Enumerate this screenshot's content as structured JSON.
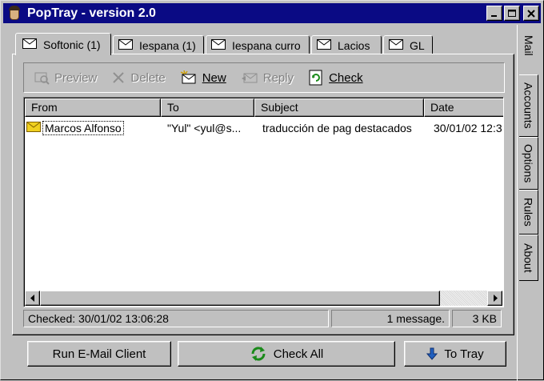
{
  "window": {
    "title": "PopTray - version 2.0"
  },
  "tabs": [
    {
      "label": "Softonic (1)",
      "active": true
    },
    {
      "label": "Iespana (1)",
      "active": false
    },
    {
      "label": "Iespana curro",
      "active": false
    },
    {
      "label": "Lacios",
      "active": false
    },
    {
      "label": "GL",
      "active": false
    }
  ],
  "toolbar": {
    "preview": "Preview",
    "delete": "Delete",
    "new": "New",
    "reply": "Reply",
    "check": "Check"
  },
  "list": {
    "columns": [
      "From",
      "To",
      "Subject",
      "Date"
    ],
    "rows": [
      {
        "from": "Marcos Alfonso",
        "to": "\"Yul\" <yul@s...",
        "subject": "traducción de pag destacados",
        "date": "30/01/02 12:3"
      }
    ]
  },
  "status": {
    "checked": "Checked: 30/01/02 13:06:28",
    "messages": "1 message.",
    "size": "3 KB"
  },
  "buttons": {
    "run_client": "Run E-Mail Client",
    "check_all": "Check All",
    "to_tray": "To Tray"
  },
  "side_tabs": [
    "Mail",
    "Accounts",
    "Options",
    "Rules",
    "About"
  ],
  "colors": {
    "title_bar": "#0a0a84",
    "face": "#c0c0c0",
    "envelope": "#f0d020",
    "check_green": "#1a8a1a"
  }
}
